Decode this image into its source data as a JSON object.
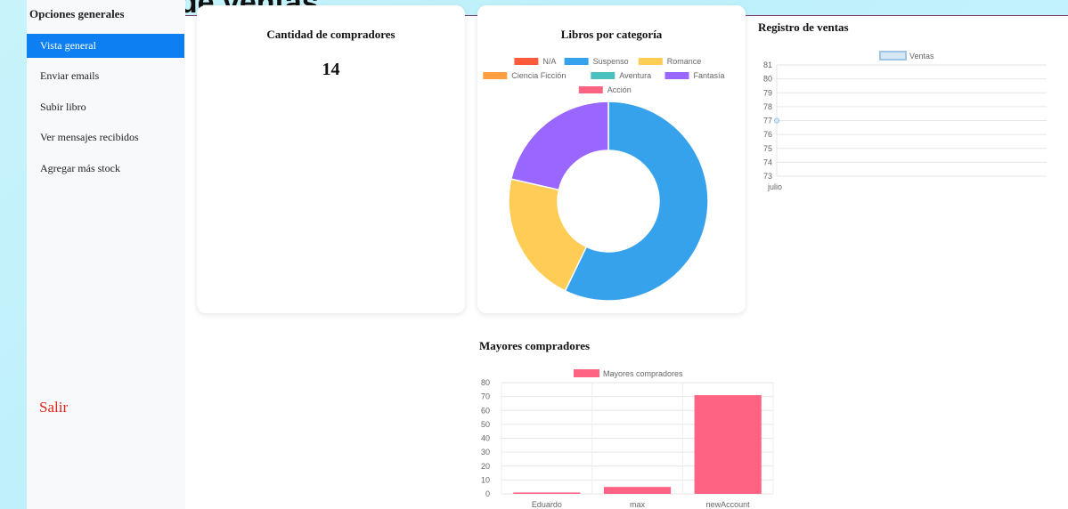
{
  "page": {
    "title": "Reportes de ventas"
  },
  "sidebar": {
    "heading": "Opciones generales",
    "items": [
      {
        "label": "Vista general",
        "active": true
      },
      {
        "label": "Enviar emails"
      },
      {
        "label": "Subir libro"
      },
      {
        "label": "Ver mensajes recibidos"
      },
      {
        "label": "Agregar más stock"
      }
    ],
    "logout_label": "Salir"
  },
  "buyers_card": {
    "title": "Cantidad de compradores",
    "value": "14"
  },
  "categories_card": {
    "title": "Libros por categoría"
  },
  "sales_section": {
    "title": "Registro de ventas"
  },
  "top_buyers_section": {
    "title": "Mayores compradores"
  },
  "colors": {
    "accent": "#0d7ff2",
    "logout": "#e2231a"
  },
  "chart_data": [
    {
      "type": "pie",
      "title": "Libros por categoría",
      "variant": "doughnut",
      "legend_position": "top",
      "categories": [
        "N/A",
        "Suspenso",
        "Romance",
        "Ciencia Ficción",
        "Aventura",
        "Fantasía",
        "Acción"
      ],
      "values": [
        0,
        8,
        3,
        0,
        0,
        3,
        0
      ],
      "colors": [
        "#ff5b3a",
        "#36a2eb",
        "#ffcd56",
        "#ff9f40",
        "#4bc0c0",
        "#9966ff",
        "#ff6384"
      ]
    },
    {
      "type": "line",
      "title": "Registro de ventas",
      "series": [
        {
          "name": "Ventas",
          "values": [
            77
          ]
        }
      ],
      "categories": [
        "julio"
      ],
      "yticks": [
        73,
        74,
        75,
        76,
        77,
        78,
        79,
        80,
        81
      ],
      "ylim": [
        73,
        81
      ],
      "legend_position": "top",
      "color": "#9ec5e6"
    },
    {
      "type": "bar",
      "title": "Mayores compradores",
      "categories": [
        "Eduardo",
        "max",
        "newAccount"
      ],
      "series": [
        {
          "name": "Mayores compradores",
          "values": [
            1,
            5,
            71
          ]
        }
      ],
      "yticks": [
        0,
        10,
        20,
        30,
        40,
        50,
        60,
        70,
        80
      ],
      "ylim": [
        0,
        80
      ],
      "legend_position": "top",
      "color": "#ff6384"
    }
  ]
}
